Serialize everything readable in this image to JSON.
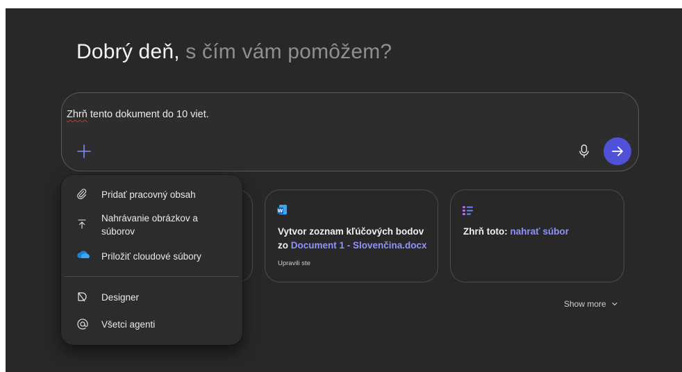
{
  "greeting": {
    "strong": "Dobrý deň,",
    "muted": "s čím vám pomôžem?"
  },
  "composer": {
    "prompt_flagged": "Zhrň",
    "prompt_rest": " tento dokument do 10 viet."
  },
  "attach_menu": {
    "items": [
      {
        "label": "Pridať pracovný obsah",
        "icon": "paperclip-icon"
      },
      {
        "label": "Nahrávanie obrázkov a súborov",
        "icon": "upload-icon"
      },
      {
        "label": "Priložiť cloudové súbory",
        "icon": "onedrive-cloud-icon"
      },
      {
        "label": "Designer",
        "icon": "designer-icon"
      },
      {
        "label": "Všetci agenti",
        "icon": "at-icon"
      }
    ]
  },
  "suggestions": [
    {
      "icon": "word-document-icon",
      "title_prefix": "Vytvor zoznam kľúčových bodov zo ",
      "title_link": "Document 1 - Slovenčina.docx",
      "meta": "Upravili ste"
    },
    {
      "icon": "summary-list-icon",
      "title_prefix": "Zhrň toto: ",
      "title_link": "nahrať súbor"
    }
  ],
  "show_more": {
    "label": "Show more"
  },
  "colors": {
    "background": "#282828",
    "accent": "#4f52d9",
    "link": "#8f93ff"
  }
}
